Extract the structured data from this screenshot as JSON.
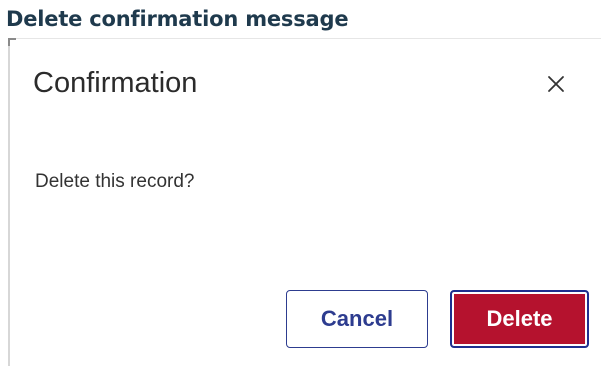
{
  "page": {
    "heading": "Delete confirmation message"
  },
  "dialog": {
    "title": "Confirmation",
    "close_icon": "close-icon",
    "message": "Delete this record?",
    "buttons": {
      "cancel_label": "Cancel",
      "delete_label": "Delete"
    }
  },
  "colors": {
    "heading": "#1f3a4d",
    "cancel_border": "#2d3c8f",
    "delete_background": "#b5122e",
    "delete_focus_ring": "#1f2f8f"
  }
}
